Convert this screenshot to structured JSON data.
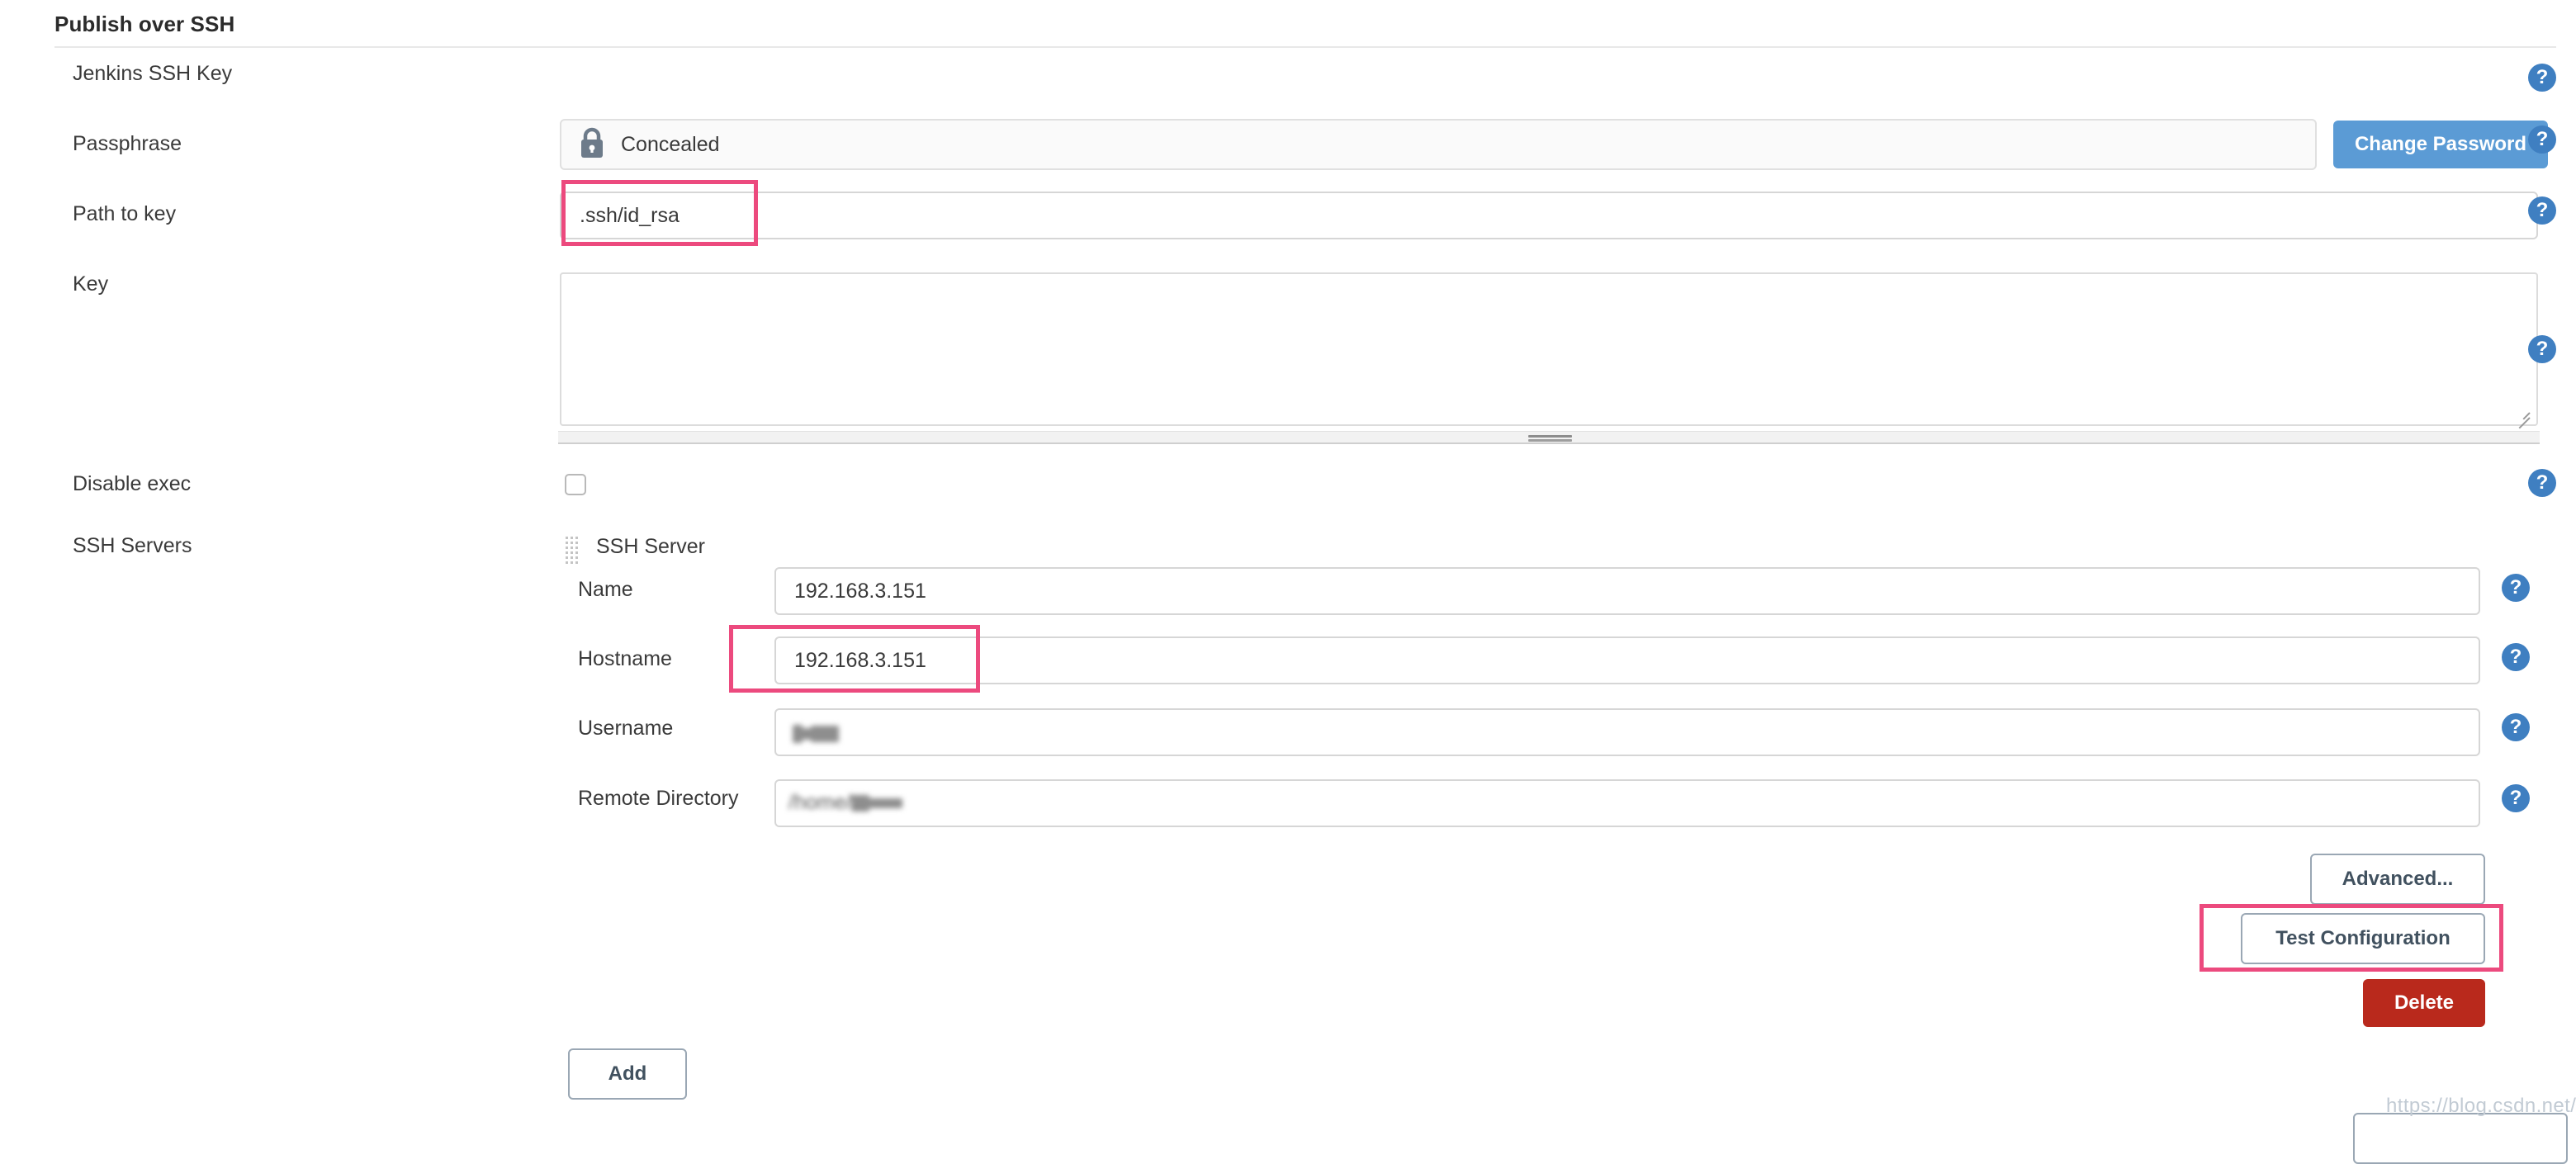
{
  "section": {
    "title": "Publish over SSH"
  },
  "fields": {
    "jenkins_ssh_key": {
      "label": "Jenkins SSH Key"
    },
    "passphrase": {
      "label": "Passphrase",
      "value": "Concealed",
      "lock_icon": "lock-icon",
      "change_password_label": "Change Password"
    },
    "path_to_key": {
      "label": "Path to key",
      "value": ".ssh/id_rsa"
    },
    "key": {
      "label": "Key",
      "value": ""
    },
    "disable_exec": {
      "label": "Disable exec",
      "checked": false
    },
    "ssh_servers": {
      "label": "SSH Servers"
    }
  },
  "ssh_server": {
    "title": "SSH Server",
    "drag_handle_icon": "drag-handle-icon",
    "name": {
      "label": "Name",
      "value": "192.168.3.151"
    },
    "hostname": {
      "label": "Hostname",
      "value": "192.168.3.151"
    },
    "username": {
      "label": "Username",
      "value": ""
    },
    "remote_directory": {
      "label": "Remote Directory",
      "value": "/home/"
    }
  },
  "buttons": {
    "advanced": "Advanced...",
    "test_configuration": "Test Configuration",
    "delete": "Delete",
    "add": "Add"
  },
  "help_icon": "?",
  "watermark": "https://blog.csdn.net/Tomonkey",
  "colors": {
    "highlight": "#ec4a7e",
    "primary_button": "#5b9bd5",
    "danger_button": "#b9291c",
    "help_icon": "#3f7fc1"
  }
}
